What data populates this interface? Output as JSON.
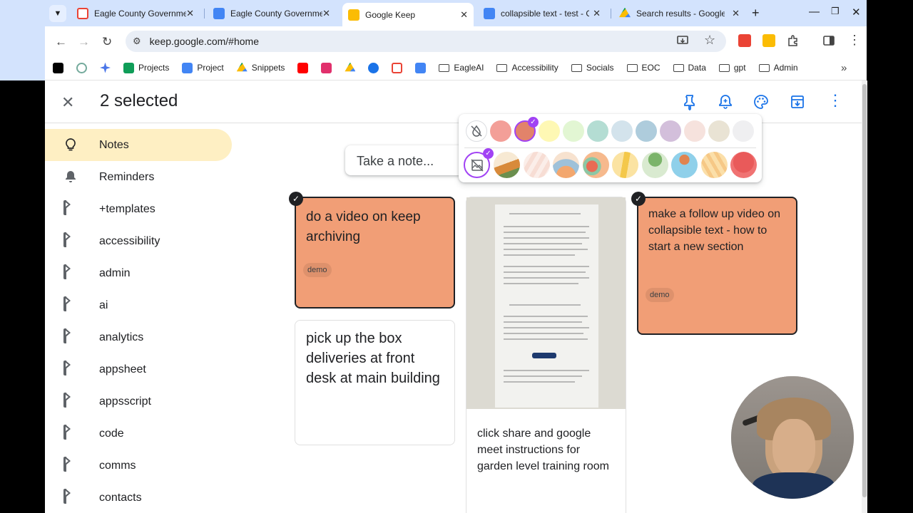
{
  "tabs": [
    {
      "title": "Eagle County Governmen",
      "icon": "gmail-icon",
      "active": false
    },
    {
      "title": "Eagle County Governmen",
      "icon": "calendar-icon",
      "active": false
    },
    {
      "title": "Google Keep",
      "icon": "keep-icon",
      "active": true
    },
    {
      "title": "collapsible text - test - Go",
      "icon": "docs-icon",
      "active": false
    },
    {
      "title": "Search results - Google D",
      "icon": "drive-icon",
      "active": false
    }
  ],
  "address_bar": {
    "url": "keep.google.com/#home"
  },
  "bookmarks": [
    {
      "label": "",
      "icon": "x-icon"
    },
    {
      "label": "",
      "icon": "chatgpt-icon"
    },
    {
      "label": "",
      "icon": "gemini-icon"
    },
    {
      "label": "Projects",
      "icon": "sheets-icon"
    },
    {
      "label": "Project",
      "icon": "docs-icon"
    },
    {
      "label": "Snippets",
      "icon": "drive-icon"
    },
    {
      "label": "",
      "icon": "youtube-icon"
    },
    {
      "label": "",
      "icon": "instagram-icon"
    },
    {
      "label": "",
      "icon": "drive-icon"
    },
    {
      "label": "",
      "icon": "chrome-store-icon"
    },
    {
      "label": "",
      "icon": "gmail-icon"
    },
    {
      "label": "",
      "icon": "calendar-icon"
    },
    {
      "label": "EagleAI",
      "icon": "folder-icon"
    },
    {
      "label": "Accessibility",
      "icon": "folder-icon"
    },
    {
      "label": "Socials",
      "icon": "folder-icon"
    },
    {
      "label": "EOC",
      "icon": "folder-icon"
    },
    {
      "label": "Data",
      "icon": "folder-icon"
    },
    {
      "label": "gpt",
      "icon": "folder-icon"
    },
    {
      "label": "Admin",
      "icon": "folder-icon"
    }
  ],
  "selection": {
    "count_label": "2 selected"
  },
  "sidebar": {
    "items": [
      {
        "label": "Notes",
        "icon": "lightbulb-icon",
        "active": true
      },
      {
        "label": "Reminders",
        "icon": "bell-icon"
      },
      {
        "label": "+templates",
        "icon": "label-icon"
      },
      {
        "label": "accessibility",
        "icon": "label-icon"
      },
      {
        "label": "admin",
        "icon": "label-icon"
      },
      {
        "label": "ai",
        "icon": "label-icon"
      },
      {
        "label": "analytics",
        "icon": "label-icon"
      },
      {
        "label": "appsheet",
        "icon": "label-icon"
      },
      {
        "label": "appsscript",
        "icon": "label-icon"
      },
      {
        "label": "code",
        "icon": "label-icon"
      },
      {
        "label": "comms",
        "icon": "label-icon"
      },
      {
        "label": "contacts",
        "icon": "label-icon"
      }
    ]
  },
  "take_note": {
    "placeholder": "Take a note..."
  },
  "notes": {
    "note1": {
      "text": "do a video on keep archiving",
      "label": "demo"
    },
    "note2": {
      "text": "pick up the box deliveries at front desk at main building"
    },
    "note3": {
      "text": "click share and google meet instructions for garden level training room"
    },
    "note4": {
      "text": "make a follow up video on collapsible text - how to start a new section",
      "label": "demo"
    }
  },
  "colors": {
    "selected_note": "#f19e76",
    "sidebar_active": "#feefc3",
    "palette": [
      "#f39f98",
      "#e2836a",
      "#fef8b4",
      "#e2f6d3",
      "#b4ddd3",
      "#d3e3ec",
      "#aeccdc",
      "#d3bfdb",
      "#f6e2dd",
      "#e9e3d4",
      "#efeff1"
    ]
  }
}
